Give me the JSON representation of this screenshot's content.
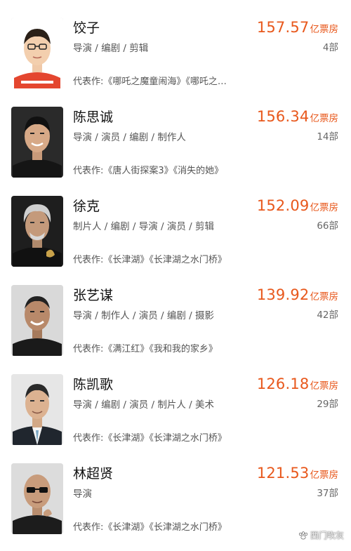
{
  "colors": {
    "accent": "#e8581c",
    "name": "#111111",
    "secondary": "#555555"
  },
  "people": [
    {
      "name": "饺子",
      "roles": "导演 / 编剧 / 剪辑",
      "works": "代表作:《哪吒之魔童闹海》《哪吒之魔童降世》",
      "box_value": "157.57",
      "box_unit": "亿票房",
      "count": "4部",
      "avatar_bg": "#ffffff",
      "shirt": "#e4462f"
    },
    {
      "name": "陈思诚",
      "roles": "导演 / 演员 / 编剧 / 制作人",
      "works": "代表作:《唐人街探案3》《消失的她》",
      "box_value": "156.34",
      "box_unit": "亿票房",
      "count": "14部",
      "avatar_bg": "#2a2a2a",
      "shirt": "#1a1a1a"
    },
    {
      "name": "徐克",
      "roles": "制片人 / 编剧 / 导演 / 演员 / 剪辑",
      "works": "代表作:《长津湖》《长津湖之水门桥》",
      "box_value": "152.09",
      "box_unit": "亿票房",
      "count": "66部",
      "avatar_bg": "#1e1e1e",
      "shirt": "#151515"
    },
    {
      "name": "张艺谋",
      "roles": "导演 / 制作人 / 演员 / 编剧 / 摄影",
      "works": "代表作:《满江红》《我和我的家乡》",
      "box_value": "139.92",
      "box_unit": "亿票房",
      "count": "42部",
      "avatar_bg": "#d9d9d9",
      "shirt": "#1a1a1a"
    },
    {
      "name": "陈凯歌",
      "roles": "导演 / 编剧 / 演员 / 制片人 / 美术",
      "works": "代表作:《长津湖》《长津湖之水门桥》",
      "box_value": "126.18",
      "box_unit": "亿票房",
      "count": "29部",
      "avatar_bg": "#e6e6e6",
      "shirt": "#20262e"
    },
    {
      "name": "林超贤",
      "roles": "导演",
      "works": "代表作:《长津湖》《长津湖之水门桥》",
      "box_value": "121.53",
      "box_unit": "亿票房",
      "count": "37部",
      "avatar_bg": "#dcdcdc",
      "shirt": "#1c1c1c"
    }
  ],
  "watermark": {
    "text": "西门吹灰",
    "icon": "paw-icon"
  }
}
